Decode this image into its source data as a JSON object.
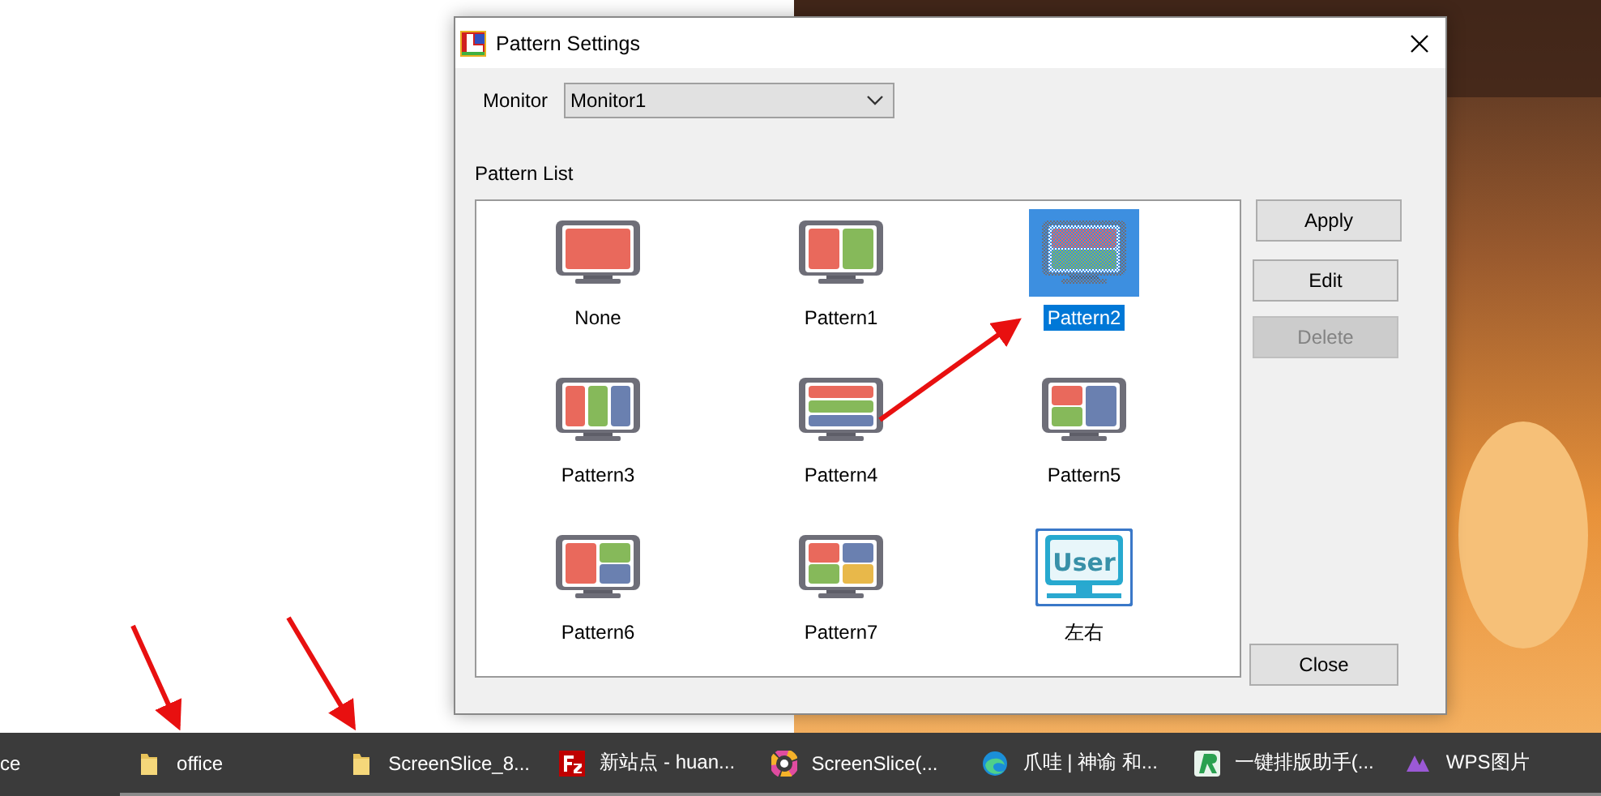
{
  "dialog": {
    "title": "Pattern Settings",
    "monitor_label": "Monitor",
    "monitor_value": "Monitor1",
    "pattern_list_label": "Pattern List",
    "pattern_rows": [
      {
        "patterns": [
          {
            "label": "None",
            "kind": "full",
            "selected": false
          },
          {
            "label": "Pattern1",
            "kind": "split2",
            "selected": false
          },
          {
            "label": "Pattern2",
            "kind": "rows2",
            "selected": true
          }
        ]
      },
      {
        "patterns": [
          {
            "label": "Pattern3",
            "kind": "cols3",
            "selected": false
          },
          {
            "label": "Pattern4",
            "kind": "rows3",
            "selected": false
          },
          {
            "label": "Pattern5",
            "kind": "quad-left",
            "selected": false
          }
        ]
      },
      {
        "patterns": [
          {
            "label": "Pattern6",
            "kind": "quad-right",
            "selected": false
          },
          {
            "label": "Pattern7",
            "kind": "quad",
            "selected": false
          },
          {
            "label": "左右",
            "kind": "user",
            "icon_text": "User",
            "selected": false
          }
        ]
      }
    ],
    "buttons": [
      {
        "label": "Apply",
        "disabled": false
      },
      {
        "label": "Edit",
        "disabled": false
      },
      {
        "label": "Delete",
        "disabled": true
      }
    ],
    "close_button": "Close"
  },
  "taskbar": {
    "items": [
      {
        "label": "ce"
      },
      {
        "label": "office"
      },
      {
        "label": "ScreenSlice_8..."
      },
      {
        "label": "新站点 - huan..."
      },
      {
        "label": "ScreenSlice(..."
      },
      {
        "label": "爪哇 | 神谕 和..."
      },
      {
        "label": "一键排版助手(..."
      },
      {
        "label": "WPS图片"
      }
    ]
  }
}
